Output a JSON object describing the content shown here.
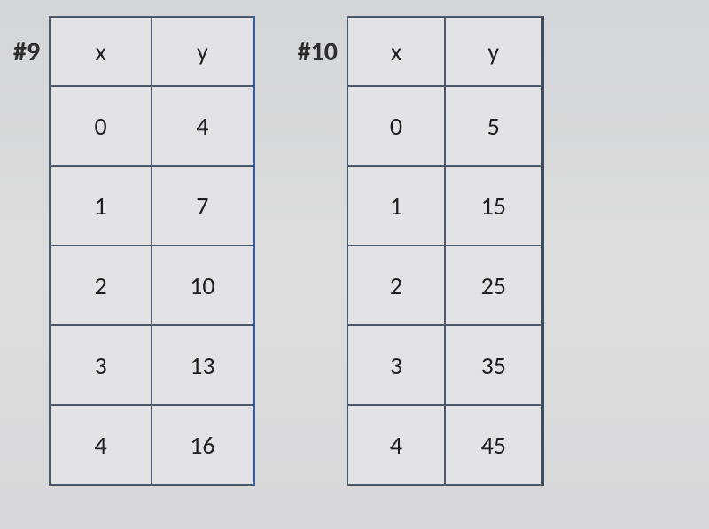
{
  "problems": [
    {
      "label": "#9",
      "headers": {
        "x": "x",
        "y": "y"
      },
      "rows": [
        {
          "x": "0",
          "y": "4"
        },
        {
          "x": "1",
          "y": "7"
        },
        {
          "x": "2",
          "y": "10"
        },
        {
          "x": "3",
          "y": "13"
        },
        {
          "x": "4",
          "y": "16"
        }
      ]
    },
    {
      "label": "#10",
      "headers": {
        "x": "x",
        "y": "y"
      },
      "rows": [
        {
          "x": "0",
          "y": "5"
        },
        {
          "x": "1",
          "y": "15"
        },
        {
          "x": "2",
          "y": "25"
        },
        {
          "x": "3",
          "y": "35"
        },
        {
          "x": "4",
          "y": "45"
        }
      ]
    }
  ]
}
